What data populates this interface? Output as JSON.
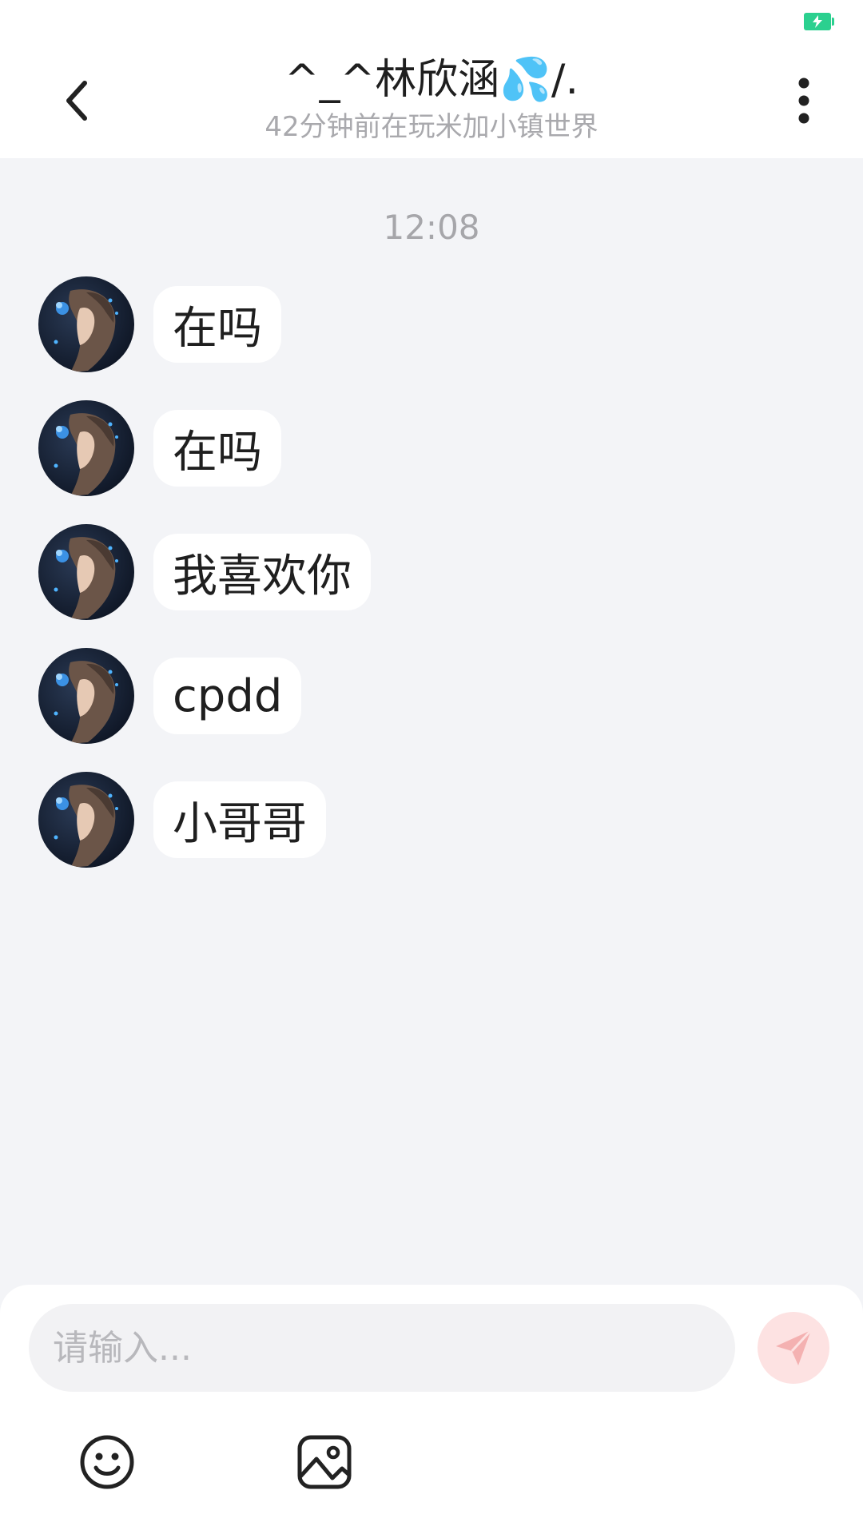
{
  "header": {
    "title": "^_^林欣涵💦/.",
    "subtitle": "42分钟前在玩米加小镇世界"
  },
  "chat": {
    "timestamp": "12:08",
    "messages": [
      {
        "text": "在吗"
      },
      {
        "text": "在吗"
      },
      {
        "text": "我喜欢你"
      },
      {
        "text": "cpdd"
      },
      {
        "text": "小哥哥"
      }
    ]
  },
  "input": {
    "placeholder": "请输入..."
  },
  "icons": {
    "back": "chevron-left-icon",
    "more": "more-vertical-icon",
    "send": "paper-plane-icon",
    "emoji": "smiley-icon",
    "image": "image-icon",
    "battery": "battery-charging-icon"
  },
  "colors": {
    "background": "#f3f4f7",
    "bubble": "#ffffff",
    "send_button": "#fde2e2",
    "send_icon": "#f4b1b1",
    "battery": "#2bd08f",
    "muted_text": "#a9a9ad"
  }
}
